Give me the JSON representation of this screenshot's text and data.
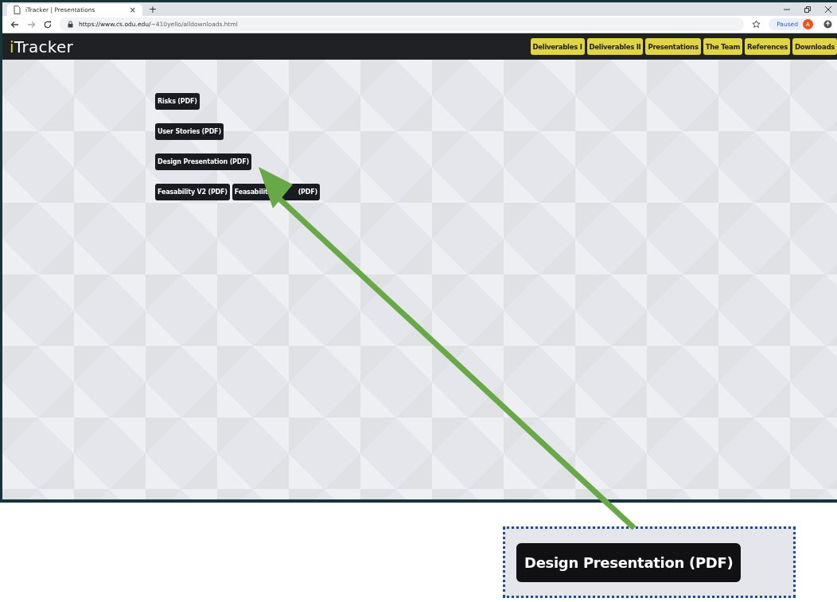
{
  "browser": {
    "tab_title": "iTracker | Presentations",
    "tab_close": "×",
    "new_tab": "+",
    "url_host": "https://www.cs.odu.edu/",
    "url_path": "~410yello/alldownloads.html",
    "profile_status": "Paused",
    "avatar_letter": "A"
  },
  "site": {
    "logo": {
      "accent": "i",
      "rest": "Tracker"
    },
    "nav": [
      {
        "label": "Deliverables I"
      },
      {
        "label": "Deliverables II"
      },
      {
        "label": "Presentations"
      },
      {
        "label": "The Team"
      },
      {
        "label": "References"
      },
      {
        "label": "Downloads"
      }
    ],
    "download_rows": [
      [
        {
          "parts": [
            "Risks (PDF)"
          ]
        }
      ],
      [
        {
          "parts": [
            "User Stories (PDF)"
          ]
        }
      ],
      [
        {
          "parts": [
            "Design Presentation (PDF)"
          ]
        }
      ],
      [
        {
          "parts": [
            "Feasability V2 (PDF)"
          ]
        },
        {
          "parts": [
            "Feasabilit",
            "(PDF)"
          ]
        }
      ]
    ]
  },
  "callout": {
    "label": "Design Presentation (PDF)"
  }
}
